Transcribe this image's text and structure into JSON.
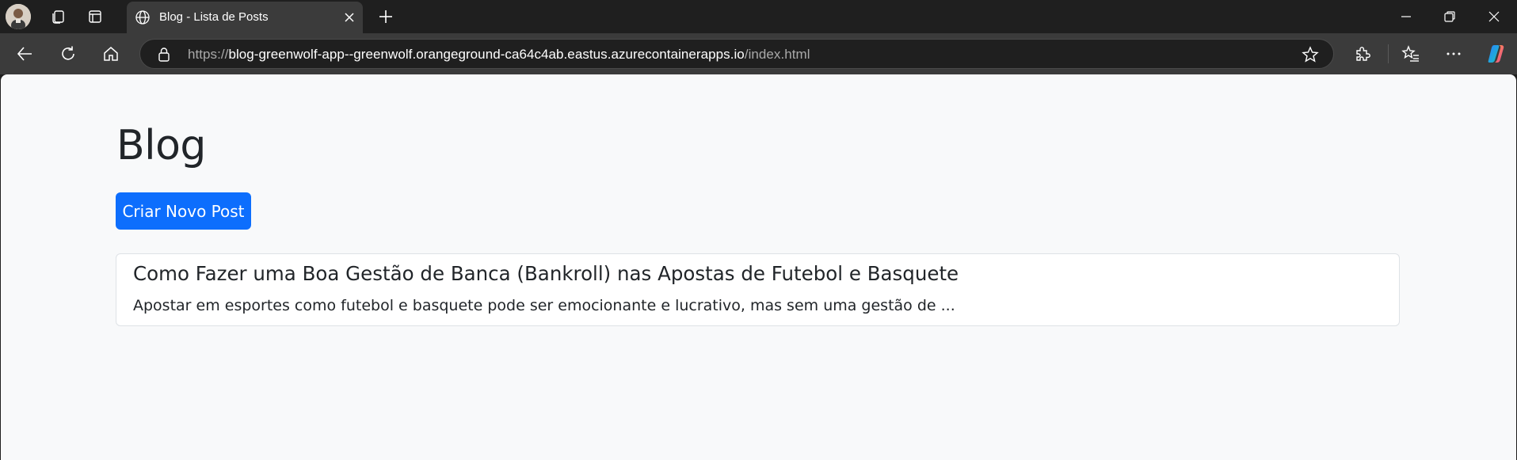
{
  "browser": {
    "tab": {
      "title": "Blog - Lista de Posts"
    },
    "address": {
      "scheme": "https://",
      "host": "blog-greenwolf-app--greenwolf.orangeground-ca64c4ab.eastus.azurecontainerapps.io",
      "path": "/index.html"
    },
    "icons": {
      "avatar": "profile-avatar",
      "workspaces": "workspaces-icon",
      "tab_actions": "tab-actions-icon",
      "tab_favicon": "globe-icon",
      "tab_close": "close-icon",
      "new_tab": "plus-icon",
      "minimize": "minimize-icon",
      "restore": "restore-icon",
      "close_window": "close-window-icon",
      "back": "back-arrow-icon",
      "refresh": "refresh-icon",
      "home": "home-icon",
      "lock": "lock-icon",
      "favorite": "star-icon",
      "extensions": "puzzle-icon",
      "favorites": "favorites-list-icon",
      "more": "more-dots-icon",
      "copilot": "copilot-icon"
    }
  },
  "page": {
    "title": "Blog",
    "new_post_button": "Criar Novo Post",
    "posts": [
      {
        "title": "Como Fazer uma Boa Gestão de Banca (Bankroll) nas Apostas de Futebol e Basquete",
        "excerpt": "Apostar em esportes como futebol e basquete pode ser emocionante e lucrativo, mas sem uma gestão de ..."
      }
    ]
  },
  "colors": {
    "primary": "#0d6efd",
    "page_bg": "#f8f9fa",
    "chrome_dark": "#1f1f1f",
    "chrome_toolbar": "#3b3b3b"
  }
}
